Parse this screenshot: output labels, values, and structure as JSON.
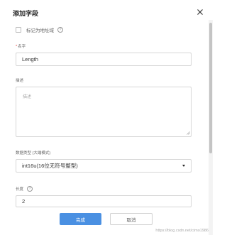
{
  "dialog": {
    "title": "添加字段",
    "close_icon": "close-icon"
  },
  "mark_address": {
    "label": "标记为地址域",
    "checked": false,
    "help_icon": "help-icon",
    "help_glyph": "?"
  },
  "name_field": {
    "required_mark": "*",
    "label": "名字",
    "value": "Length"
  },
  "description_field": {
    "label": "描述",
    "placeholder": "描述"
  },
  "data_type_field": {
    "label": "数据类型 (大端模式)",
    "selected": "int16u(16位无符号整型)",
    "arrow_icon": "caret-down-icon"
  },
  "length_field": {
    "label": "长度",
    "help_icon": "help-icon",
    "help_glyph": "?",
    "value": "2"
  },
  "actions": {
    "confirm_label": "完成",
    "cancel_label": "取消"
  },
  "watermark": {
    "text": "https://blog.csdn.net/cimo1986"
  },
  "colors": {
    "primary": "#4a90e2",
    "required": "#e53935"
  }
}
